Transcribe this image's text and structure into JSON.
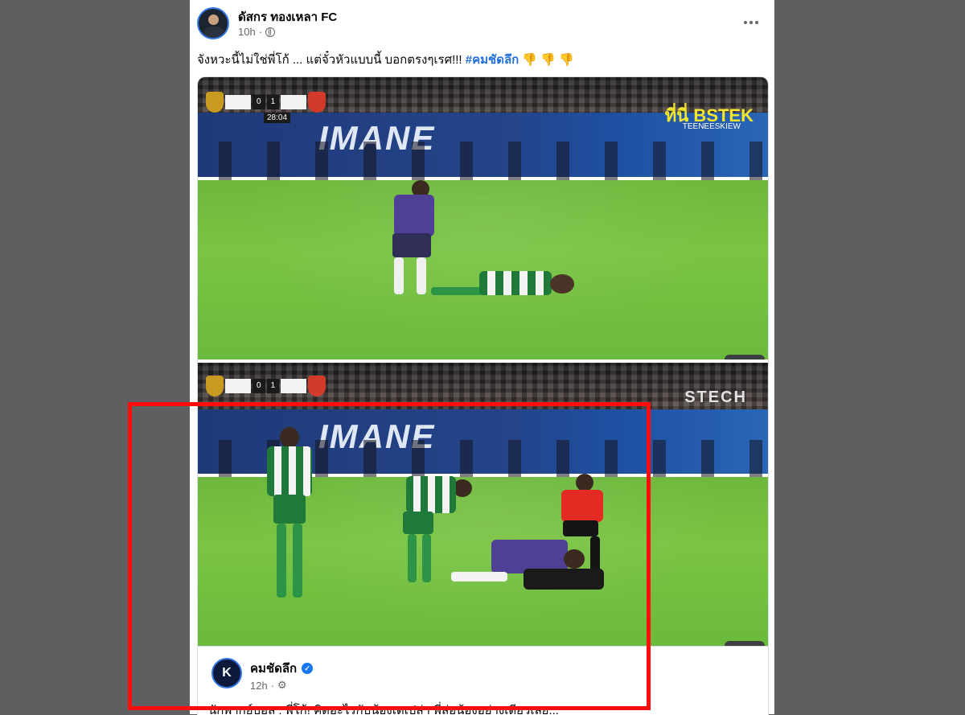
{
  "post": {
    "author": "ดัสกร ทองเหลา FC",
    "time": "10h",
    "separator": "·",
    "text": "จังหวะนี้ไม่ใช่พี่โก้ ... แต่จั๋วหัวแบบนี้ บอกตรงๆเรศ!!! ",
    "hashtag": "#คมชัดลึก",
    "emojis": "👎 👎 👎"
  },
  "photo1": {
    "score_home": "0",
    "score_away": "1",
    "clock": "28:04",
    "banner": "IMANE",
    "watermark": "ที่นี่ BSTEK",
    "watermark_sub": "TEENEESKIEW"
  },
  "photo2": {
    "score_home": "0",
    "score_away": "1",
    "banner": "IMANE",
    "watermark": "STECH"
  },
  "shared": {
    "page_name": "คมชัดลึก",
    "avatar_letter": "K",
    "time": "12h",
    "separator": "·",
    "text": "นักพากย์บอล : พี่โก้! คิดอะไรกับน้องเตเปล่า พี่ล่อน้องอย่างเดียวเลย..."
  },
  "colors": {
    "highlight": "#ff0d0d",
    "link": "#216fdb",
    "background": "#5f5e61"
  },
  "icons": [
    "globe-icon",
    "more-icon",
    "verified-icon",
    "settings-icon"
  ]
}
